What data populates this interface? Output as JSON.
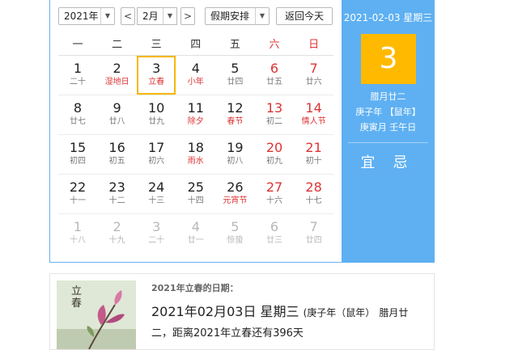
{
  "toolbar": {
    "year_value": "2021年",
    "prev_symbol": "<",
    "month_value": "2月",
    "next_symbol": ">",
    "holiday_value": "假期安排",
    "today_button": "返回今天"
  },
  "weekdays": [
    "一",
    "二",
    "三",
    "四",
    "五",
    "六",
    "日"
  ],
  "weeks": [
    [
      {
        "d": "1",
        "l": "二十"
      },
      {
        "d": "2",
        "l": "湿地日",
        "hl": true
      },
      {
        "d": "3",
        "l": "立春",
        "hl": true,
        "today": true
      },
      {
        "d": "4",
        "l": "小年",
        "hl": true
      },
      {
        "d": "5",
        "l": "廿四"
      },
      {
        "d": "6",
        "l": "廿五"
      },
      {
        "d": "7",
        "l": "廿六"
      }
    ],
    [
      {
        "d": "8",
        "l": "廿七"
      },
      {
        "d": "9",
        "l": "廿八"
      },
      {
        "d": "10",
        "l": "廿九"
      },
      {
        "d": "11",
        "l": "除夕",
        "hl": true
      },
      {
        "d": "12",
        "l": "春节",
        "hl": true
      },
      {
        "d": "13",
        "l": "初二"
      },
      {
        "d": "14",
        "l": "情人节",
        "hl": true
      }
    ],
    [
      {
        "d": "15",
        "l": "初四"
      },
      {
        "d": "16",
        "l": "初五"
      },
      {
        "d": "17",
        "l": "初六"
      },
      {
        "d": "18",
        "l": "雨水",
        "hl": true
      },
      {
        "d": "19",
        "l": "初八"
      },
      {
        "d": "20",
        "l": "初九"
      },
      {
        "d": "21",
        "l": "初十"
      }
    ],
    [
      {
        "d": "22",
        "l": "十一"
      },
      {
        "d": "23",
        "l": "十二"
      },
      {
        "d": "24",
        "l": "十三"
      },
      {
        "d": "25",
        "l": "十四"
      },
      {
        "d": "26",
        "l": "元宵节",
        "hl": true
      },
      {
        "d": "27",
        "l": "十六"
      },
      {
        "d": "28",
        "l": "十七"
      }
    ],
    [
      {
        "d": "1",
        "l": "十八",
        "dim": true
      },
      {
        "d": "2",
        "l": "十九",
        "dim": true
      },
      {
        "d": "3",
        "l": "二十",
        "dim": true
      },
      {
        "d": "4",
        "l": "廿一",
        "dim": true
      },
      {
        "d": "5",
        "l": "惊蛰",
        "dim": true
      },
      {
        "d": "6",
        "l": "廿三",
        "dim": true
      },
      {
        "d": "7",
        "l": "廿四",
        "dim": true
      }
    ]
  ],
  "side": {
    "date_line": "2021-02-03 星期三",
    "day": "3",
    "lunar1": "腊月廿二",
    "lunar2": "庚子年 【鼠年】",
    "lunar3": "庚寅月 壬午日",
    "yi": "宜",
    "ji": "忌"
  },
  "info": {
    "heading": "2021年立春的日期：",
    "date_big": "2021年02月03日 星期三",
    "date_small": "(庚子年（鼠年）",
    "date_tail": "腊月廿",
    "line2": "二，距离2021年立春还有396天",
    "thumb_text": "立春"
  },
  "colors": {
    "accent": "#5eb0f2",
    "today": "#ffba00",
    "festival": "#d33333"
  }
}
